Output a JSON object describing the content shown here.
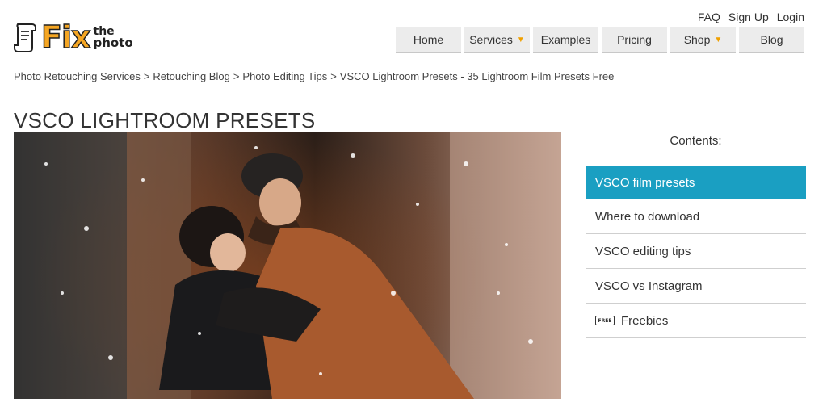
{
  "logo": {
    "main": "Fix",
    "sub_top": "the",
    "sub_bottom": "photo"
  },
  "top_links": [
    "FAQ",
    "Sign Up",
    "Login"
  ],
  "nav": [
    {
      "label": "Home",
      "dropdown": false
    },
    {
      "label": "Services",
      "dropdown": true
    },
    {
      "label": "Examples",
      "dropdown": false
    },
    {
      "label": "Pricing",
      "dropdown": false
    },
    {
      "label": "Shop",
      "dropdown": true
    },
    {
      "label": "Blog",
      "dropdown": false
    }
  ],
  "breadcrumb": [
    "Photo Retouching Services",
    "Retouching Blog",
    "Photo Editing Tips",
    "VSCO Lightroom Presets - 35 Lightroom Film Presets Free"
  ],
  "breadcrumb_sep": ">",
  "page_title": "VSCO LIGHTROOM PRESETS",
  "contents": {
    "title": "Contents:",
    "items": [
      {
        "label": "VSCO film presets",
        "active": true
      },
      {
        "label": "Where to download",
        "active": false
      },
      {
        "label": "VSCO editing tips",
        "active": false
      },
      {
        "label": "VSCO vs Instagram",
        "active": false
      },
      {
        "label": "Freebies",
        "active": false,
        "icon": "free-tag-icon",
        "icon_text": "FREE"
      }
    ]
  },
  "colors": {
    "accent": "#1a9fc2",
    "logo": "#f5a623",
    "chevron": "#f0a000"
  }
}
